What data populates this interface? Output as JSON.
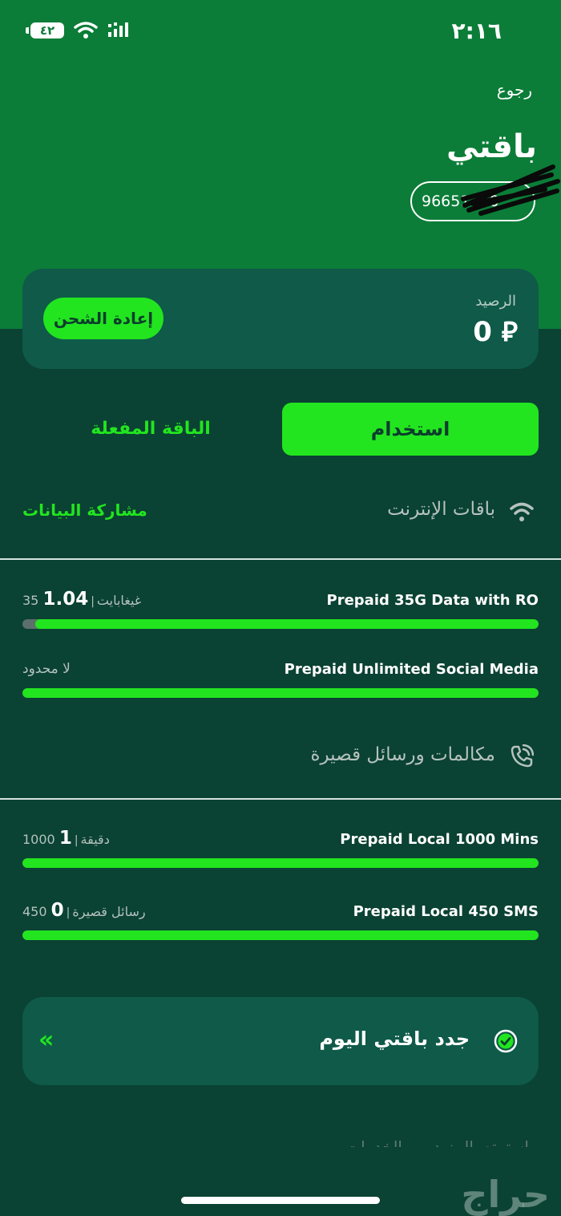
{
  "status_bar": {
    "time": "٢:١٦",
    "battery": "٤٢"
  },
  "header": {
    "back": "رجوع",
    "title": "باقتي",
    "phone_number": "96651110"
  },
  "balance": {
    "label": "الرصيد",
    "amount": "0",
    "currency_symbol": "⃁",
    "recharge_button": "إعادة الشحن"
  },
  "tabs": [
    {
      "label": "استخدام",
      "active": true
    },
    {
      "label": "الباقة المفعلة",
      "active": false
    }
  ],
  "internet": {
    "title": "باقات الإنترنت",
    "data_sharing": "مشاركة البيانات",
    "items": [
      {
        "name": "Prepaid 35G Data with RO",
        "used": "1.04",
        "total": "35 غيغابايت",
        "remaining_fraction": 0.975
      },
      {
        "name": "Prepaid Unlimited Social Media",
        "unlimited_label": "لا محدود",
        "remaining_fraction": 1.0
      }
    ]
  },
  "calls": {
    "title": "مكالمات ورسائل قصيرة",
    "items": [
      {
        "name": "Prepaid Local 1000 Mins",
        "used": "1",
        "total": "1000 دقيقة",
        "remaining_fraction": 1.0
      },
      {
        "name": "Prepaid Local 450 SMS",
        "used": "0",
        "total": "450 رسائل قصيرة",
        "remaining_fraction": 1.0
      }
    ]
  },
  "renew": {
    "label": "جدد باقتي اليوم",
    "arrow": "«"
  },
  "footer": {
    "faded_text": "استمتع بالمزيد من الخدمات",
    "watermark": "حراج"
  },
  "colors": {
    "accent": "#22e51f",
    "header_green": "#0b7d38",
    "background": "#0a4233",
    "card": "#0f5a49"
  }
}
